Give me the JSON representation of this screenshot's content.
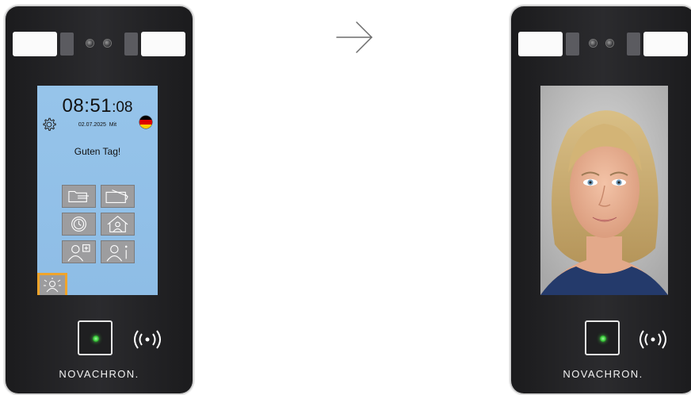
{
  "left_device": {
    "screen": {
      "clock_hm": "08:51",
      "clock_sec": ":08",
      "date": "02.07.2025",
      "weekday": "Mit",
      "greeting": "Guten Tag!",
      "language_flag": "germany-flag-icon",
      "settings_icon": "gear-icon",
      "buttons": [
        {
          "icon": "folder-card-icon"
        },
        {
          "icon": "card-swipe-icon"
        },
        {
          "icon": "clock-icon"
        },
        {
          "icon": "home-user-icon"
        },
        {
          "icon": "add-user-icon"
        },
        {
          "icon": "user-info-icon"
        }
      ],
      "face_button": {
        "icon": "face-recognition-icon",
        "highlight_color": "#f0a42b"
      }
    },
    "brand": "NOVACHRON."
  },
  "transition": {
    "icon": "arrow-right-icon"
  },
  "right_device": {
    "screen": {
      "content": "face-photo"
    },
    "brand": "NOVACHRON."
  },
  "colors": {
    "screen_bg": "#8ebde6",
    "device_body": "#232325",
    "highlight": "#f0a42b",
    "led": "#2fbd2f"
  }
}
